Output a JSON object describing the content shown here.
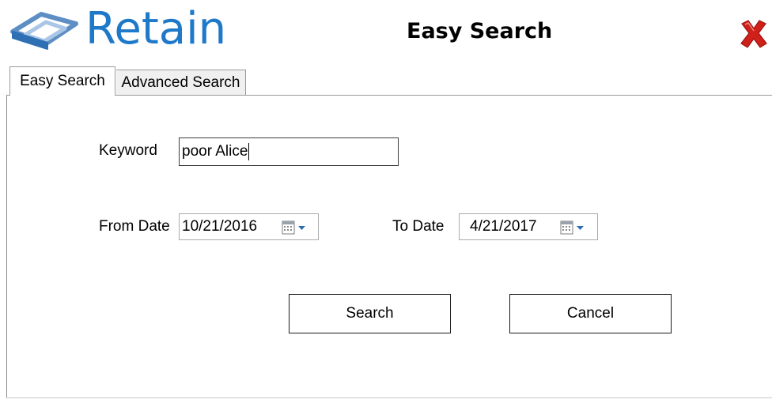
{
  "header": {
    "logo_text": "Retain",
    "title": "Easy Search"
  },
  "tabs": [
    {
      "label": "Easy Search",
      "active": true
    },
    {
      "label": "Advanced Search",
      "active": false
    }
  ],
  "form": {
    "keyword_label": "Keyword",
    "keyword_value": "poor Alice",
    "from_date_label": "From Date",
    "from_date_value": "10/21/2016",
    "to_date_label": "To Date",
    "to_date_value": "4/21/2017"
  },
  "buttons": {
    "search_label": "Search",
    "cancel_label": "Cancel"
  },
  "colors": {
    "brand_blue": "#1e79c9",
    "close_red": "#d0201a"
  },
  "icons": {
    "logo": "retain-logo-icon",
    "close": "close-icon",
    "date_picker": "calendar-dropdown-icon"
  }
}
